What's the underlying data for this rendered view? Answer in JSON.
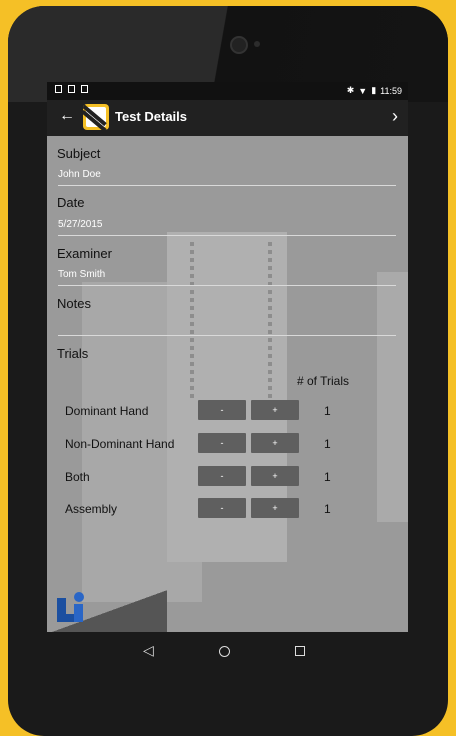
{
  "status": {
    "time": "11:59"
  },
  "toolbar": {
    "title": "Test Details"
  },
  "form": {
    "subject_label": "Subject",
    "subject_value": "John Doe",
    "date_label": "Date",
    "date_value": "5/27/2015",
    "examiner_label": "Examiner",
    "examiner_value": "Tom Smith",
    "notes_label": "Notes",
    "notes_value": ""
  },
  "trials": {
    "heading": "Trials",
    "count_header": "# of Trials",
    "rows": [
      {
        "label": "Dominant Hand",
        "minus": "-",
        "plus": "+",
        "count": "1"
      },
      {
        "label": "Non-Dominant Hand",
        "minus": "-",
        "plus": "+",
        "count": "1"
      },
      {
        "label": "Both",
        "minus": "-",
        "plus": "+",
        "count": "1"
      },
      {
        "label": "Assembly",
        "minus": "-",
        "plus": "+",
        "count": "1"
      }
    ]
  },
  "colors": {
    "accent": "#f5c026",
    "toolbar": "#212121",
    "button": "#5f5f5f",
    "brand_blue": "#1b4fa0"
  }
}
